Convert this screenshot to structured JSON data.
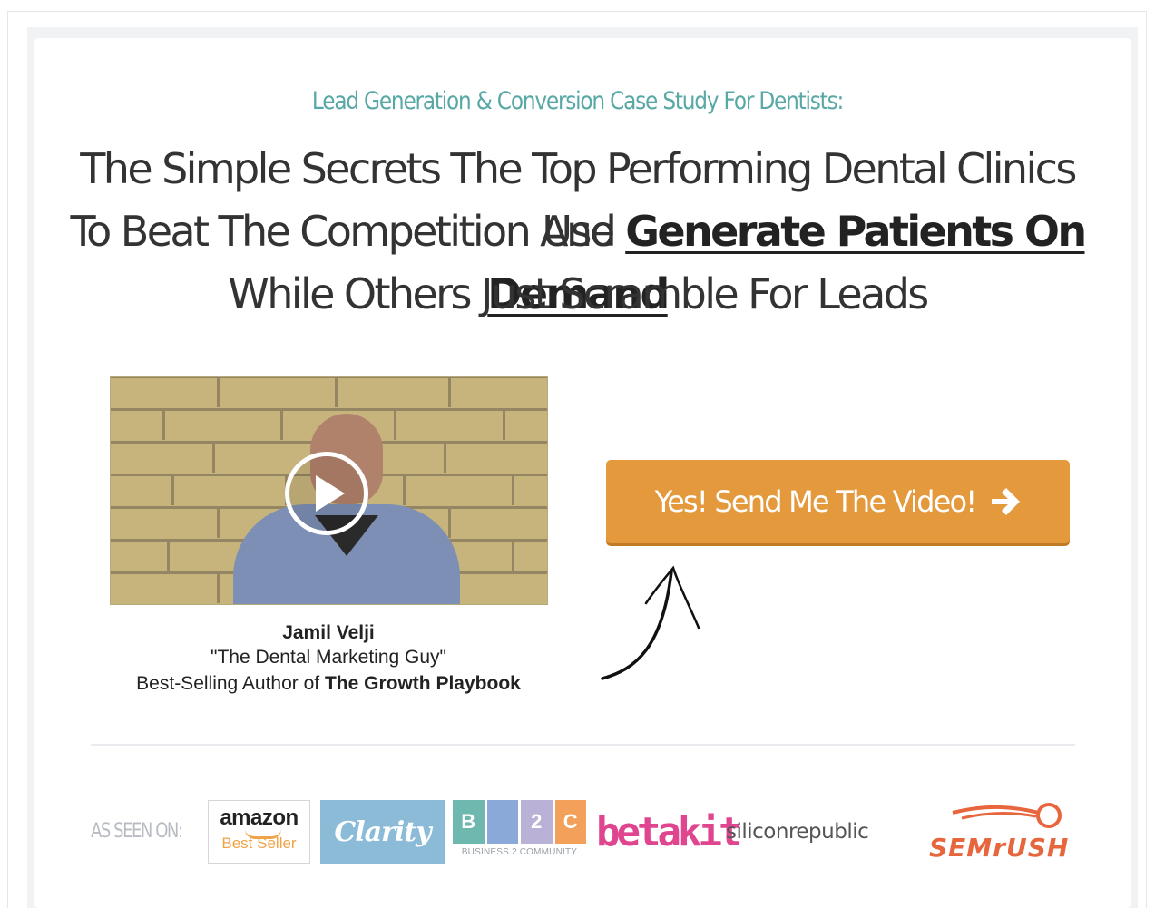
{
  "header": {
    "eyebrow": "Lead Generation & Conversion Case Study For Dentists:",
    "headline_line1": "The Simple Secrets The Top Performing Dental Clinics Use",
    "headline_line2_prefix": "To Beat The Competition And ",
    "headline_line2_highlight": "Generate Patients On Demand",
    "headline_line3": "While Others Just Scramble For Leads"
  },
  "video": {
    "play_icon": "play-icon"
  },
  "author": {
    "name": "Jamil Velji",
    "tagline": "\"The Dental Marketing Guy\"",
    "credit_prefix": "Best-Selling Author of ",
    "book": "The Growth Playbook"
  },
  "cta": {
    "label": "Yes! Send Me The Video!",
    "icon": "arrow-right-icon"
  },
  "colors": {
    "accent_teal": "#58a8a6",
    "cta_orange": "#e49a3c"
  },
  "as_seen_on": {
    "label": "AS SEEN ON:",
    "logos": {
      "amazon_line1": "amazon",
      "amazon_line2": "Best Seller",
      "clarity": "Clarity",
      "b2c_b": "B",
      "b2c_2": "2",
      "b2c_c": "C",
      "b2c_sub": "BUSINESS 2 COMMUNITY",
      "betakit": "betakit",
      "silicon": "siliconrepublic",
      "semrush": "SEMrUSH"
    }
  }
}
